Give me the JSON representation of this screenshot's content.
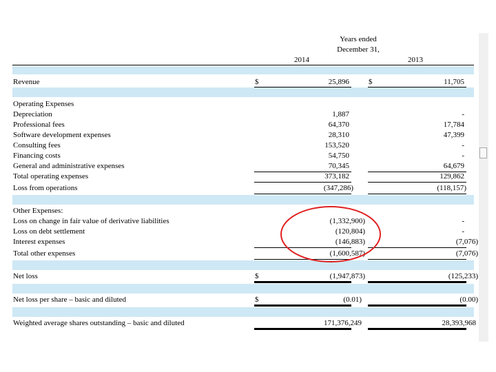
{
  "header": {
    "years_ended": "Years ended",
    "december": "December 31,",
    "year_2014": "2014",
    "year_2013": "2013"
  },
  "currency_symbol": "$",
  "rows": {
    "revenue": {
      "label": "Revenue",
      "v2014": "25,896",
      "v2013": "11,705"
    },
    "operating_expenses": {
      "label": "Operating Expenses"
    },
    "depreciation": {
      "label": "Depreciation",
      "v2014": "1,887",
      "v2013": "-"
    },
    "professional_fees": {
      "label": "Professional fees",
      "v2014": "64,370",
      "v2013": "17,784"
    },
    "software_dev": {
      "label": "Software development expenses",
      "v2014": "28,310",
      "v2013": "47,399"
    },
    "consulting_fees": {
      "label": "Consulting fees",
      "v2014": "153,520",
      "v2013": "-"
    },
    "financing_costs": {
      "label": "Financing costs",
      "v2014": "54,750",
      "v2013": "-"
    },
    "general_admin": {
      "label": "General and administrative expenses",
      "v2014": "70,345",
      "v2013": "64,679"
    },
    "total_operating": {
      "label": "Total operating expenses",
      "v2014": "373,182",
      "v2013": "129,862"
    },
    "loss_operations": {
      "label": "Loss from operations",
      "v2014": "(347,286)",
      "v2013": "(118,157)"
    },
    "other_expenses": {
      "label": "Other Expenses:"
    },
    "loss_derivative": {
      "label": "Loss on change in fair value of derivative liabilities",
      "v2014": "(1,332,900)",
      "v2013": "-"
    },
    "loss_debt": {
      "label": "Loss on debt settlement",
      "v2014": "(120,804)",
      "v2013": "-"
    },
    "interest": {
      "label": "Interest expenses",
      "v2014": "(146,883)",
      "v2013": "(7,076)"
    },
    "total_other": {
      "label": "Total other expenses",
      "v2014": "(1,600,587)",
      "v2013": "(7,076)"
    },
    "net_loss": {
      "label": "Net loss",
      "v2014": "(1,947,873)",
      "v2013": "(125,233)"
    },
    "net_loss_per_share": {
      "label": "Net loss per share – basic and diluted",
      "v2014": "(0.01)",
      "v2013": "(0.00)"
    },
    "weighted_shares": {
      "label": "Weighted average shares outstanding – basic and diluted",
      "v2014": "171,376,249",
      "v2013": "28,393,968"
    }
  },
  "annotation": {
    "shape": "red-ellipse",
    "color": "#e02020"
  },
  "colors": {
    "band": "#cfe8f5",
    "scrollbar": "#f0f0f0"
  }
}
